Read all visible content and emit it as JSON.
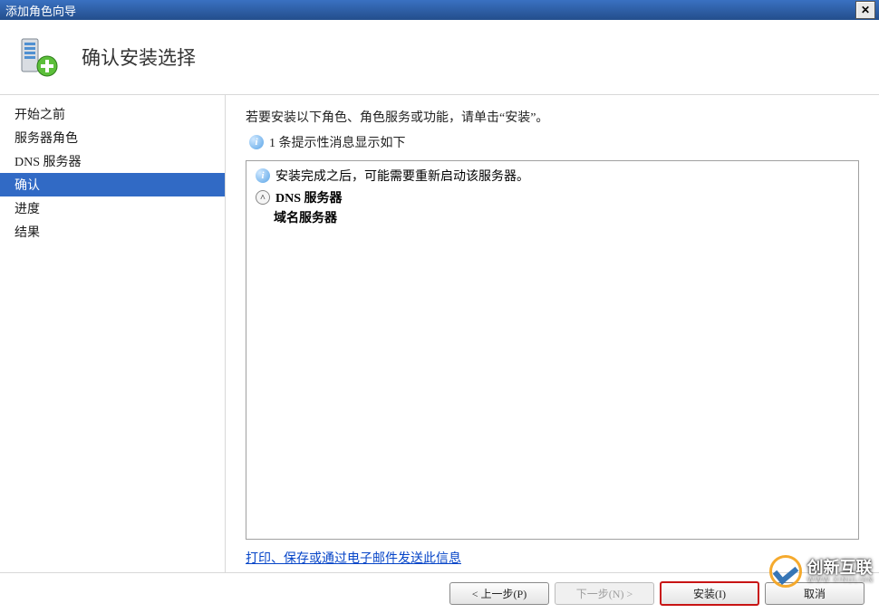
{
  "window": {
    "title": "添加角色向导",
    "close_symbol": "✕"
  },
  "header": {
    "title": "确认安装选择"
  },
  "sidebar": {
    "items": [
      {
        "label": "开始之前",
        "selected": false
      },
      {
        "label": "服务器角色",
        "selected": false
      },
      {
        "label": "DNS 服务器",
        "selected": false
      },
      {
        "label": "确认",
        "selected": true
      },
      {
        "label": "进度",
        "selected": false
      },
      {
        "label": "结果",
        "selected": false
      }
    ]
  },
  "content": {
    "intro": "若要安装以下角色、角色服务或功能，请单击“安装”。",
    "info_icon_glyph": "i",
    "info_text": "1 条提示性消息显示如下",
    "warning_text": "安装完成之后，可能需要重新启动该服务器。",
    "role_name": "DNS 服务器",
    "expand_glyph": "˄",
    "service_name": "域名服务器",
    "link_text": "打印、保存或通过电子邮件发送此信息"
  },
  "buttons": {
    "prev": "< 上一步(P)",
    "next": "下一步(N) >",
    "install": "安装(I)",
    "cancel": "取消"
  },
  "watermark": {
    "text": "创新互联",
    "sub": "WWW.XINULIAN"
  }
}
